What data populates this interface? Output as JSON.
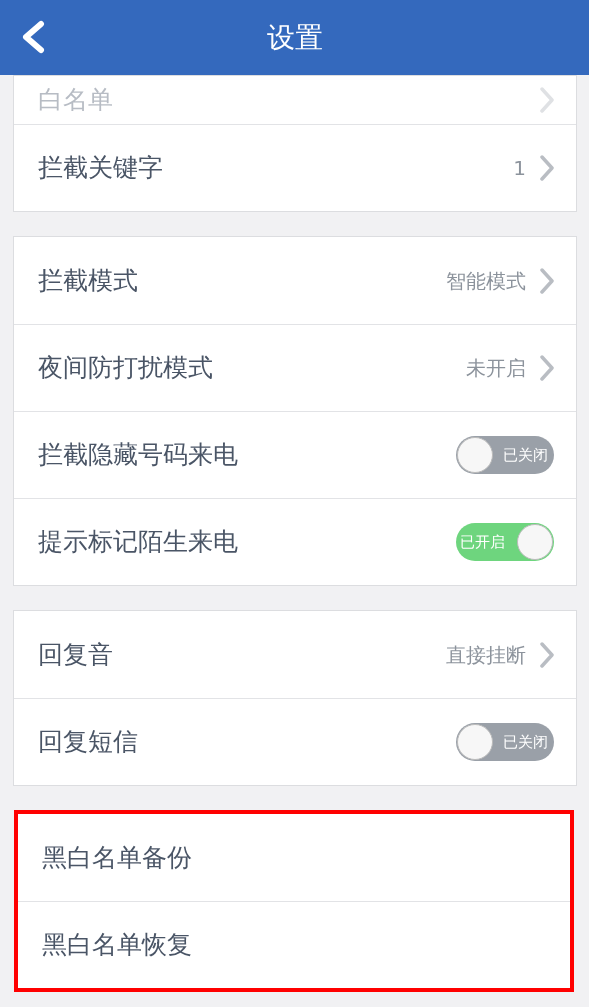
{
  "header": {
    "title": "设置"
  },
  "groups": [
    {
      "highlighted": false,
      "rows": [
        {
          "kind": "link",
          "label": "白名单",
          "faded": true
        },
        {
          "kind": "link",
          "label": "拦截关键字",
          "value": "1"
        }
      ]
    },
    {
      "highlighted": false,
      "rows": [
        {
          "kind": "link",
          "label": "拦截模式",
          "value": "智能模式"
        },
        {
          "kind": "link",
          "label": "夜间防打扰模式",
          "value": "未开启"
        },
        {
          "kind": "toggle",
          "label": "拦截隐藏号码来电",
          "on": false,
          "state_text": "已关闭"
        },
        {
          "kind": "toggle",
          "label": "提示标记陌生来电",
          "on": true,
          "state_text": "已开启"
        }
      ]
    },
    {
      "highlighted": false,
      "rows": [
        {
          "kind": "link",
          "label": "回复音",
          "value": "直接挂断"
        },
        {
          "kind": "toggle",
          "label": "回复短信",
          "on": false,
          "state_text": "已关闭"
        }
      ]
    },
    {
      "highlighted": true,
      "rows": [
        {
          "kind": "plain",
          "label": "黑白名单备份"
        },
        {
          "kind": "plain",
          "label": "黑白名单恢复"
        }
      ]
    }
  ]
}
